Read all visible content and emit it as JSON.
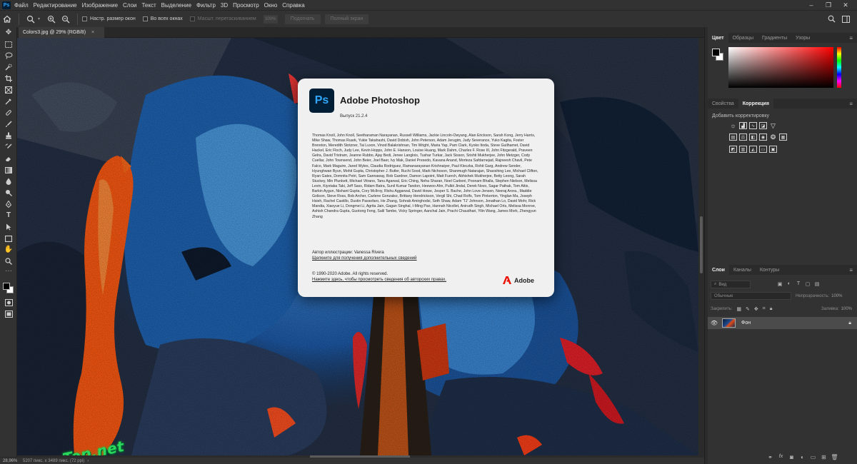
{
  "menubar": {
    "items": [
      "Файл",
      "Редактирование",
      "Изображение",
      "Слои",
      "Текст",
      "Выделение",
      "Фильтр",
      "3D",
      "Просмотр",
      "Окно",
      "Справка"
    ]
  },
  "options_bar": {
    "resize_windows": "Настр. размер окон",
    "all_windows": "Во всех окнах",
    "scrubby_zoom": "Масшт. перетаскиванием",
    "zoom_value": "100%",
    "fit_button": "Подогнать",
    "fill_button": "Полный экран"
  },
  "document": {
    "tab_title": "Colors3.jpg @ 29% (RGB/8)",
    "status_zoom": "28,96%",
    "status_info": "5207 пикс. x 3489 пикс. (72 ppi)"
  },
  "watermark": "Prog-Top.net",
  "splash": {
    "title": "Adobe Photoshop",
    "version": "Выпуск 21.2.4",
    "credits": "Thomas Knoll, John Knoll, Seetharaman Narayanan, Russell Williams, Jackie Lincoln-Owyang, Alan Erickson, Sarah Kong, Jerry Harris, Mike Shaw, Thomas Ruark, Yukie Takahashi, David Dobish, John Peterson, Adam Jerugim, Judy Severance, Yuko Kagita, Foster Brereton, Meredith Stotzner, Tai Luxon, Vinod Balakrishnan, Tim Wright, Maria Yap, Pam Clark, Kyoko Itoda, Steve Guilhamet, David Hackel, Eric Floch, Judy Lee, Kevin Hopps, John E. Hanson, Louise Huang, Mark Dahm, Charles F. Rose III, John Fitzgerald, Praveen Gelra, David Tristram, Jeanne Rubbo, Ajay Bedi, Jenee Langlois, Tushar Turkar, Jack Sisson, Srishti Mukherjee, John Metzger, Cody Cuellar, John Townsend, John Beier, Joel Baer, Ivy Mak, Daniel Presedo, Kavana Anand, Morteza Safdarnejad, Rajneesh Chavli, Pete Falco, Mark Maguire, Jared Wyles, Claudia Rodriguez, Ramanarayanan Krishnaiyer, Paul Kleczka, Rohit Garg, Andrew Sender, Hyunghwan Byun, Mohit Gupta, Christopher J. Butler, Ruchi Sood, Mark Nichoson, Shanmugh Natarajan, Shaoshing Lee, Michael Clifton, Ryan Gates, Domnita Petri, Sam Gannaway, Bob Gardner, Damon Lapoint, Matt Fuerch, Abhishek Mukherjee, Betty Leong, Sarah Stuckey, Min Plunkett, Michael Vitrano, Tanu Agarwal, Eric Ching, Neha Sharan, Noel Carboni, Poonam Bhalla, Stephen Nielson, Melissa Levin, Kiyotaka Taki, Jeff Sass, Ridam Batra, Sunil Kumar Tandon, Heewoo Ahn, Pulkit Jindal, Derek Novo, Sagar Pathak, Tom Attix, Barkin Aygun, Nishant Gupta, Cory McIlroy, Rishu Aggarwal, David Howe, Jesper S. Bache, John Love-Jensen, Neeraj Arora., Maddie Golison, Steve Ross, Bob Archer, Carlene Gonzalez, Brittany Hendrickson, Vergil Shi, Chad Rolfs, Tom Pinkerton, Yinglan Ma, Joseph Hsieh, Rachel Castillo, Dustin Passofaro, He Zhang, Sohrab Amirghodsi, Seth Shaw, Adam 'TJ' Johnson, Jonathan Lo, David Mohr, Rick Mandia, Xiaoyue Li, Dongmei Li, Agrita Jain, Gagan Singhal, I-Ming Pao, Hannah Nicollet, Anirudh Singh, Michael Orts, Melissa Monroe, Ashish Chandra Gupta, Guotong Feng, Salil Tambe, Vicky Springer, Aanchal Jain, Prachi Chaudhari, Yilin Wang, James Mork, Zhengyun Zhang",
    "artist": "Автор иллюстрации: Vanessa Rivera",
    "details_link": "Щелкните для получения дополнительных сведений",
    "copyright": "© 1990-2020 Adobe. All rights reserved.",
    "legal_link": "Нажмите здесь, чтобы просмотреть сведения об авторских правах.",
    "brand": "Adobe"
  },
  "panels": {
    "color_tabs": [
      "Цвет",
      "Образцы",
      "Градиенты",
      "Узоры"
    ],
    "props_tabs": [
      "Свойства",
      "Коррекция"
    ],
    "adjustments_label": "Добавить корректировку",
    "layers_tabs": [
      "Слои",
      "Каналы",
      "Контуры"
    ],
    "layer_search": "Вид",
    "blend_mode": "Обычные",
    "opacity_label": "Непрозрачность:",
    "opacity_value": "100%",
    "lock_label": "Закрепить:",
    "fill_label": "Заливка:",
    "fill_value": "100%",
    "layer_name": "Фон"
  },
  "colors": {
    "accent_ps": "#31a8ff",
    "ps_bg": "#001e36",
    "adobe_red": "#eb1000"
  }
}
